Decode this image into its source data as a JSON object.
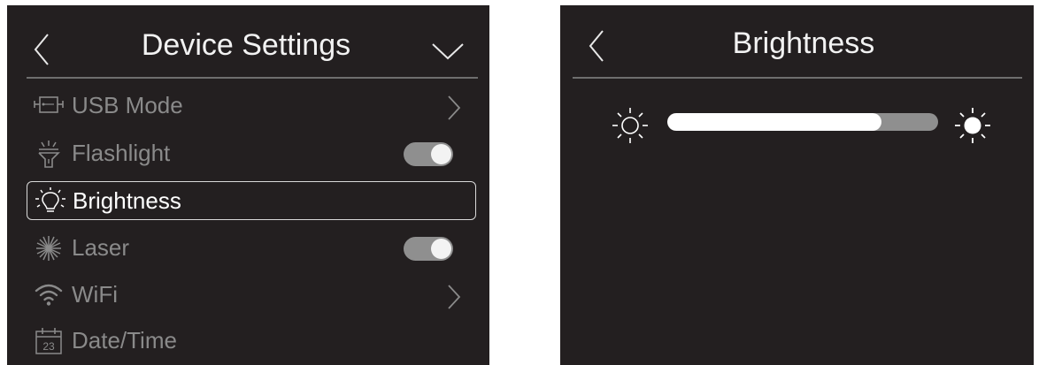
{
  "colors": {
    "panel_bg": "#231f20",
    "text_active": "#ffffff",
    "text_inactive": "#8a8a8a",
    "toggle_on": "#8f8f8f"
  },
  "device_settings": {
    "title": "Device Settings",
    "back_icon": "chevron-left-icon",
    "dropdown_icon": "chevron-down-icon",
    "items": [
      {
        "label": "USB Mode",
        "icon": "usb-icon",
        "control": "chevron-right",
        "selected": false
      },
      {
        "label": "Flashlight",
        "icon": "flashlight-icon",
        "control": "toggle",
        "toggle_on": true,
        "selected": false
      },
      {
        "label": "Brightness",
        "icon": "lightbulb-icon",
        "control": "none",
        "selected": true
      },
      {
        "label": "Laser",
        "icon": "laser-icon",
        "control": "toggle",
        "toggle_on": true,
        "selected": false
      },
      {
        "label": "WiFi",
        "icon": "wifi-icon",
        "control": "chevron-right",
        "selected": false
      },
      {
        "label": "Date/Time",
        "icon": "calendar-icon",
        "calendar_number": "23",
        "control": "none",
        "selected": false
      }
    ]
  },
  "brightness": {
    "title": "Brightness",
    "back_icon": "chevron-left-icon",
    "min_icon": "sun-dim-icon",
    "max_icon": "sun-bright-icon",
    "level_fraction": 0.79
  }
}
